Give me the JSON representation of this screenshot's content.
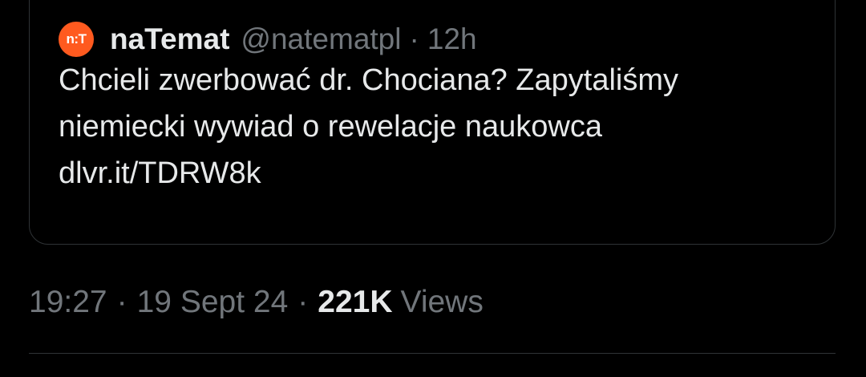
{
  "quoted_tweet": {
    "avatar_text": "n:T",
    "display_name": "naTemat",
    "handle": "@natematpl",
    "separator": "·",
    "time_ago": "12h",
    "text_lines": [
      "Chcieli zwerbować dr. Chociana? Zapytaliśmy",
      "niemiecki wywiad o rewelacje naukowca",
      "dlvr.it/TDRW8k"
    ]
  },
  "meta": {
    "time": "19:27",
    "separator": "·",
    "date": "19 Sept 24",
    "views_count": "221K",
    "views_label": "Views"
  },
  "colors": {
    "background": "#000000",
    "text_primary": "#e7e9ea",
    "text_secondary": "#71767b",
    "border": "#2f3336",
    "avatar_brand": "#ff5a1f"
  }
}
